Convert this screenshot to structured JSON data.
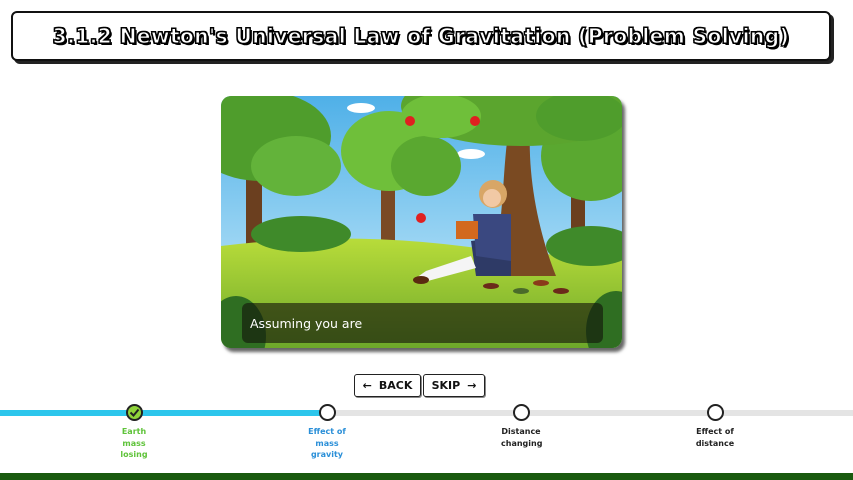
{
  "title": "3.1.2 Newton's Universal Law of Gravitation (Problem Solving)",
  "caption": "Assuming you are",
  "nav": {
    "back_label": "BACK",
    "skip_label": "SKIP"
  },
  "progress": {
    "fraction": 0.385
  },
  "steps": [
    {
      "label": "Earth mass losing",
      "state": "done"
    },
    {
      "label": "Effect of mass gravity",
      "state": "current"
    },
    {
      "label": "Distance changing",
      "state": "todo"
    },
    {
      "label": "Effect of distance",
      "state": "todo"
    }
  ],
  "colors": {
    "progress": "#2cc6ec",
    "done": "#8fd33a",
    "footer": "#1a5a0f"
  }
}
